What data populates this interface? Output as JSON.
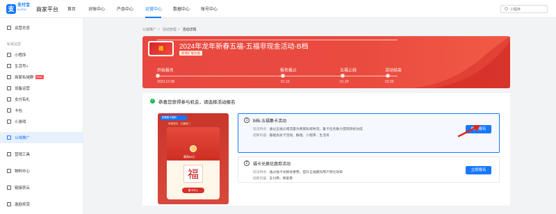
{
  "topnav": {
    "logo_text": "支付宝",
    "logo_sub": "ALIPAY",
    "platform": "商家平台",
    "items": [
      {
        "label": "首页"
      },
      {
        "label": "对账中心"
      },
      {
        "label": "产品中心"
      },
      {
        "label": "运营中心"
      },
      {
        "label": "数据中心"
      },
      {
        "label": "账号中心"
      }
    ],
    "active_index": 3,
    "search_placeholder": "小程序"
  },
  "sidebar": {
    "items": [
      {
        "label": "运营总览"
      },
      {
        "label": "小程序"
      },
      {
        "label": "生活号+"
      },
      {
        "label": "商家私域群",
        "badge": "New"
      },
      {
        "label": "设备运营"
      },
      {
        "label": "支付有礼"
      },
      {
        "label": "卡包"
      },
      {
        "label": "小游戏"
      },
      {
        "label": "公域推广"
      },
      {
        "label": "营销工具"
      },
      {
        "label": "物料中心"
      },
      {
        "label": "链接获云"
      },
      {
        "label": "激励奖赏"
      }
    ],
    "section_label": "私域运营",
    "active_index": 8
  },
  "breadcrumb": {
    "items": [
      "公域推广",
      "活动管理",
      "活动详情"
    ]
  },
  "banner": {
    "thumb_text": "福",
    "title": "2024年龙年新春五福-五福非现金活动-B档",
    "tag": "新增扩展功能",
    "timeline": [
      {
        "label": "开始报名",
        "date": "2023.12.08"
      },
      {
        "label": "报名截止",
        "date": "01.10"
      },
      {
        "label": "五福上线",
        "date": "01.29"
      },
      {
        "label": "活动结束",
        "date": "02.09"
      }
    ]
  },
  "card": {
    "congrats": "恭喜您获得参与机会，请选择活动报名",
    "preview": {
      "header": "新春集卡福利",
      "header2": "恭喜发财，五福临门",
      "coin_text": "最高88元",
      "fu": "福",
      "button": "集卡中心"
    },
    "options": [
      {
        "num": "1",
        "name": "B档-五福集卡活动",
        "feature_key": "玩法特点:",
        "feature": "通过五福公域流量为商家私域导流，集卡任务助力提现目标达成",
        "scope_key": "招商内容:",
        "scope": "基础会员卡活动、群组、小程序、生活号",
        "button": "继续报名",
        "selected": true
      },
      {
        "num": "2",
        "name": "福卡兑换优惠券活动",
        "feature_key": "玩法特点:",
        "feature": "通过福卡兑换优惠券，提升五福期间用户转化效率",
        "scope_key": "招商内容:",
        "scope": "支付券、商家券",
        "button": "立即报名",
        "selected": false
      }
    ]
  },
  "colors": {
    "accent": "#1677ff",
    "banner_red": "#e8483f",
    "success": "#1db954"
  }
}
